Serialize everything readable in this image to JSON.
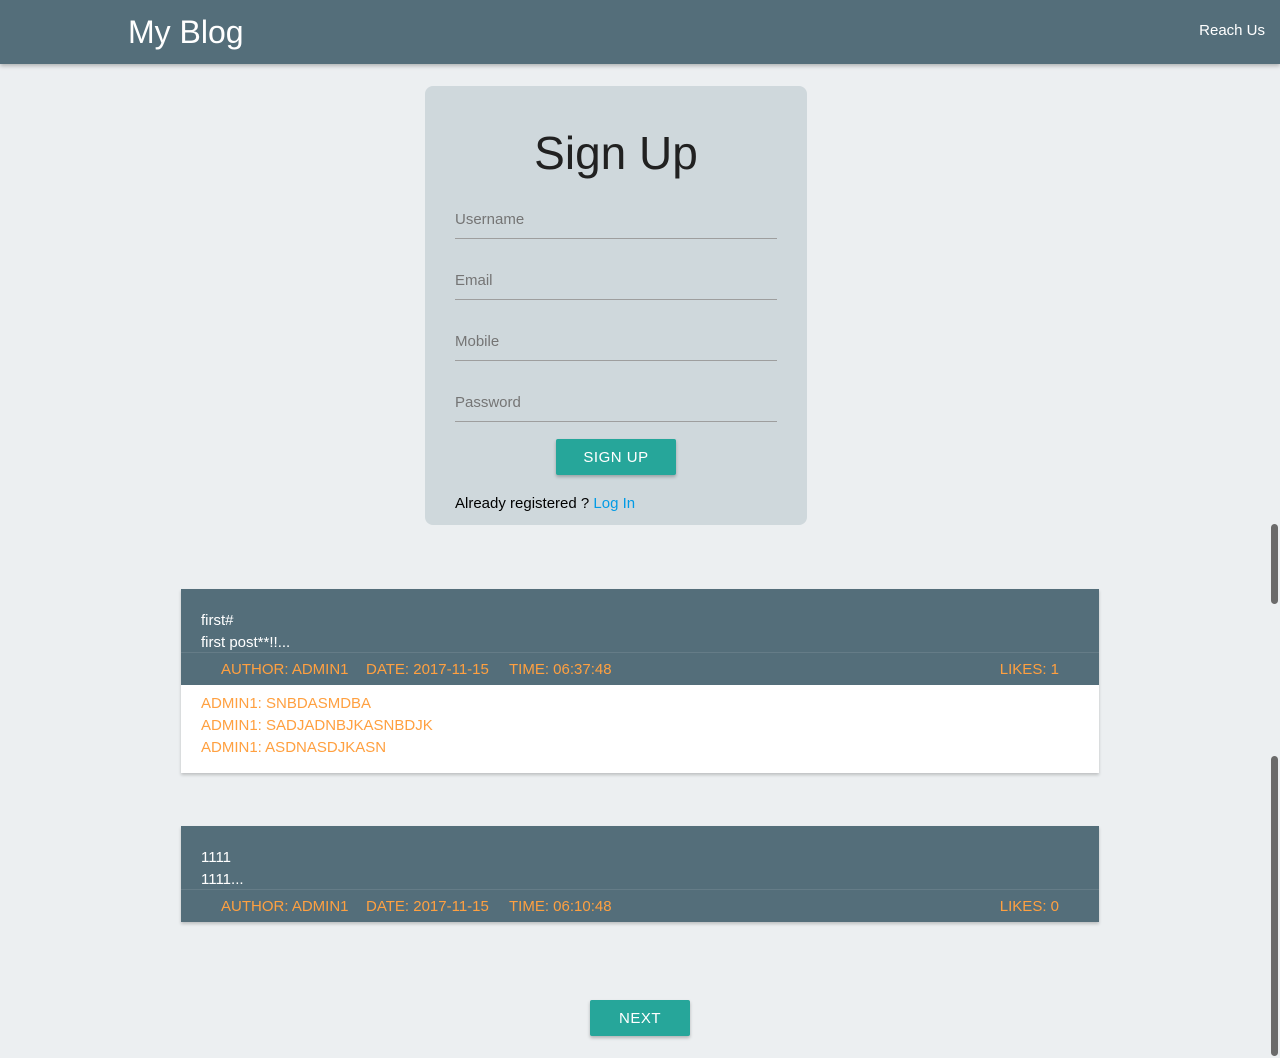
{
  "nav": {
    "brand": "My Blog",
    "reach_us": "Reach Us"
  },
  "signup": {
    "title": "Sign Up",
    "username_placeholder": "Username",
    "email_placeholder": "Email",
    "mobile_placeholder": "Mobile",
    "password_placeholder": "Password",
    "button": "Sign Up",
    "already_text": "Already registered ? ",
    "login_link": "Log In"
  },
  "posts": [
    {
      "title": "first#",
      "excerpt": "first post**!!...",
      "author": "Author: admin1",
      "date": "Date: 2017-11-15",
      "time": "Time: 06:37:48",
      "likes": "Likes: 1",
      "comments": [
        "admin1: snbdasmdba",
        "admin1: sadjadnbjkasnbdjk",
        "admin1: asdnasdjkasn"
      ]
    },
    {
      "title": "1111",
      "excerpt": "1111...",
      "author": "Author: admin1",
      "date": "Date: 2017-11-15",
      "time": "Time: 06:10:48",
      "likes": "Likes: 0"
    }
  ],
  "pagination": {
    "next": "Next"
  },
  "colors": {
    "navbar": "#546e7a",
    "card": "#cfd8dc",
    "button": "#26a69a",
    "meta_text": "#ffa040",
    "link": "#039be5"
  }
}
